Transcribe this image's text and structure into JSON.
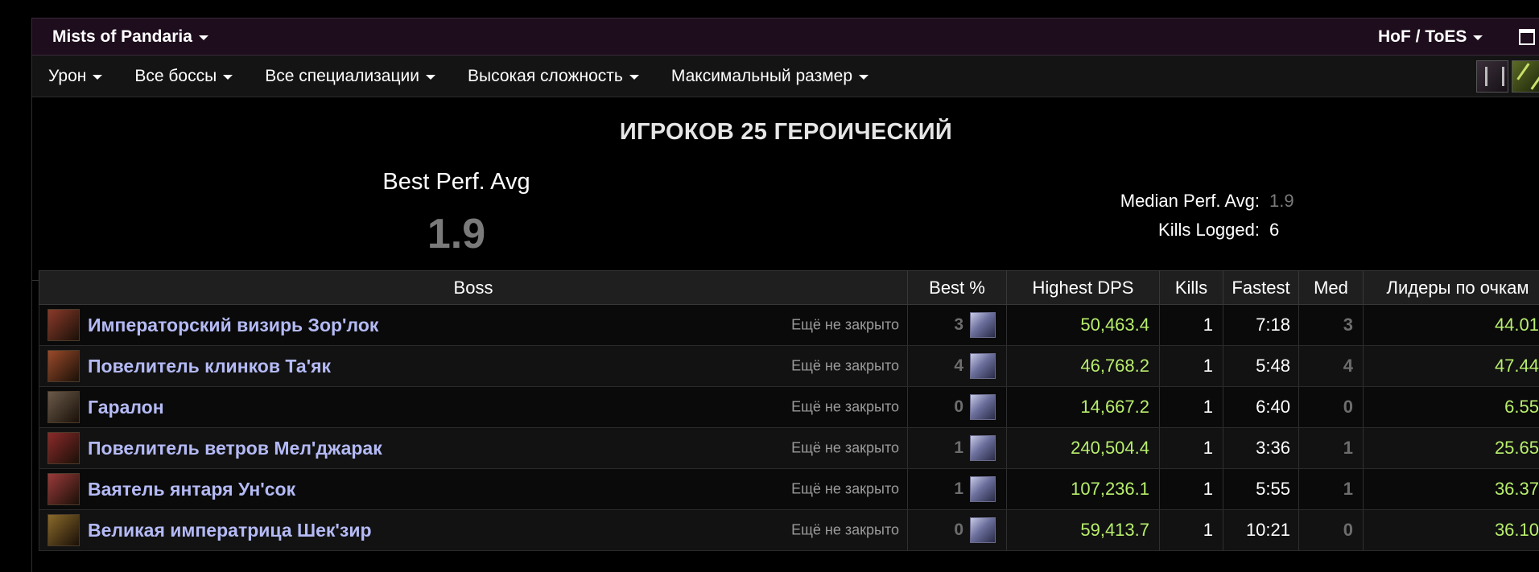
{
  "topbar": {
    "expansion": "Mists of Pandaria",
    "raid": "HoF / ToES"
  },
  "filters": [
    {
      "label": "Урон"
    },
    {
      "label": "Все боссы"
    },
    {
      "label": "Все специализации"
    },
    {
      "label": "Высокая сложность"
    },
    {
      "label": "Максимальный размер"
    }
  ],
  "summary": {
    "difficulty": "ИГРОКОВ 25 ГЕРОИЧЕСКИЙ",
    "best_label": "Best Perf. Avg",
    "best_value": "1.9",
    "median_label": "Median Perf. Avg:",
    "median_value": "1.9",
    "kills_label": "Kills Logged:",
    "kills_value": "6"
  },
  "table": {
    "headers": [
      "Boss",
      "Best %",
      "Highest DPS",
      "Kills",
      "Fastest",
      "Med",
      "Лидеры по очкам"
    ],
    "rows": [
      {
        "boss": "Императорский визирь Зор'лок",
        "status": "Ещё не закрыто",
        "best": "3",
        "dps": "50,463.4",
        "kills": "1",
        "fastest": "7:18",
        "med": "3",
        "points": "44.01",
        "icon_color": "#8a3a2a"
      },
      {
        "boss": "Повелитель клинков Та'як",
        "status": "Ещё не закрыто",
        "best": "4",
        "dps": "46,768.2",
        "kills": "1",
        "fastest": "5:48",
        "med": "4",
        "points": "47.44",
        "icon_color": "#9a4a2a"
      },
      {
        "boss": "Гаралон",
        "status": "Ещё не закрыто",
        "best": "0",
        "dps": "14,667.2",
        "kills": "1",
        "fastest": "6:40",
        "med": "0",
        "points": "6.55",
        "icon_color": "#6a5a4a"
      },
      {
        "boss": "Повелитель ветров Мел'джарак",
        "status": "Ещё не закрыто",
        "best": "1",
        "dps": "240,504.4",
        "kills": "1",
        "fastest": "3:36",
        "med": "1",
        "points": "25.65",
        "icon_color": "#8a2a2a"
      },
      {
        "boss": "Ваятель янтаря Ун'сок",
        "status": "Ещё не закрыто",
        "best": "1",
        "dps": "107,236.1",
        "kills": "1",
        "fastest": "5:55",
        "med": "1",
        "points": "36.37",
        "icon_color": "#9a3a3a"
      },
      {
        "boss": "Великая императрица Шек'зир",
        "status": "Ещё не закрыто",
        "best": "0",
        "dps": "59,413.7",
        "kills": "1",
        "fastest": "10:21",
        "med": "0",
        "points": "36.10",
        "icon_color": "#8a6a2a"
      }
    ]
  }
}
